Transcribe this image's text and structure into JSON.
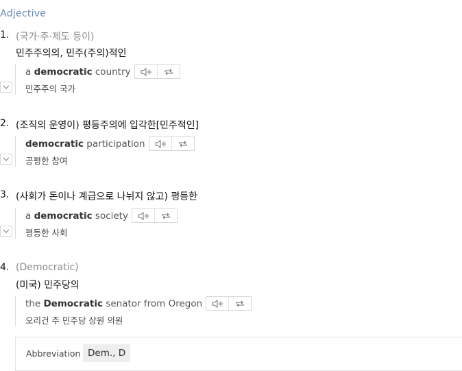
{
  "pos_label": "Adjective",
  "senses": [
    {
      "number": "1.",
      "qualifier": "(국가·주·제도 등이)",
      "definition": "민주주의의, 민주(주의)적인",
      "example": {
        "pre": "a ",
        "bold": "democratic",
        "post": " country",
        "translation": "민주주의 국가"
      }
    },
    {
      "number": "2.",
      "definition": "(조직의 운영이) 평등주의에 입각한[민주적인]",
      "example": {
        "pre": "",
        "bold": "democratic",
        "post": " participation",
        "translation": "공평한 참여"
      }
    },
    {
      "number": "3.",
      "definition": "(사회가 돈이나 계급으로 나뉘지 않고) 평등한",
      "example": {
        "pre": "a ",
        "bold": "democratic",
        "post": " society",
        "translation": "평등한 사회"
      }
    },
    {
      "number": "4.",
      "qualifier": "(Democratic)",
      "definition": "(미국) 민주당의",
      "example": {
        "pre": "the ",
        "bold": "Democratic",
        "post": " senator from Oregon",
        "translation": "오리건 주 민주당 상원 의원"
      }
    }
  ],
  "abbreviation": {
    "label": "Abbreviation",
    "value": "Dem., D"
  },
  "icons": {
    "speaker": "speaker-icon",
    "repeat": "repeat-icon",
    "toggle": "chevron-down-icon"
  },
  "colors": {
    "pos_label": "#6a8caf",
    "qualifier": "#8a8a8a",
    "border": "#d8d8d8"
  }
}
